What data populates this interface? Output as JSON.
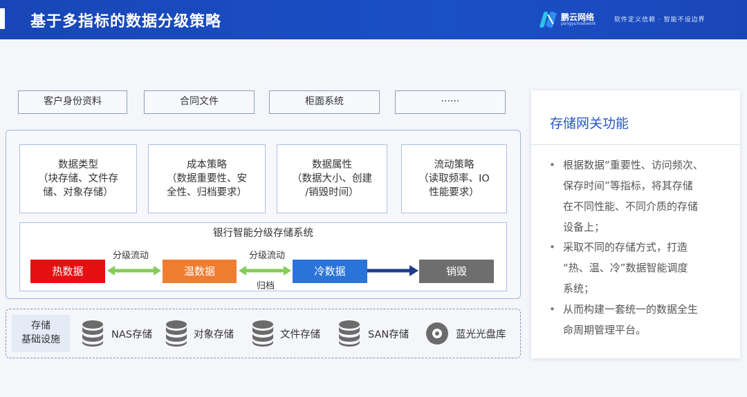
{
  "header": {
    "title": "基于多指标的数据分级策略",
    "logo_cn": "鹏云网络",
    "logo_en": "pengyunnetwork",
    "slogan": "软件定义信赖 · 智能不设边界"
  },
  "sources": [
    "客户身份资料",
    "合同文件",
    "柜面系统",
    "······"
  ],
  "strategies": [
    {
      "title": "数据类型",
      "lines": [
        "（块存储、文件存",
        "储、对象存储）"
      ]
    },
    {
      "title": "成本策略",
      "lines": [
        "（数据重要性、安",
        "全性、归档要求）"
      ]
    },
    {
      "title": "数据属性",
      "lines": [
        "（数据大小、创建",
        "/销毁时间）"
      ]
    },
    {
      "title": "流动策略",
      "lines": [
        "（读取频率、IO",
        "性能要求）"
      ]
    }
  ],
  "bank_system": {
    "title": "银行智能分级存储系统",
    "tiers": [
      {
        "label": "热数据",
        "color": "#e60f12"
      },
      {
        "label": "温数据",
        "color": "#ee7d31"
      },
      {
        "label": "冷数据",
        "color": "#2a74d9"
      },
      {
        "label": "销毁",
        "color": "#6e6e6e"
      }
    ],
    "flow_labels": [
      "分级流动",
      "分级流动",
      "归档"
    ],
    "flow_arrow_color": "#84cc5b",
    "archive_arrow_color": "#1f3b8f"
  },
  "infrastructure": {
    "label_lines": [
      "存储",
      "基础设施"
    ],
    "items": [
      {
        "label": "NAS存储",
        "icon": "database-icon"
      },
      {
        "label": "对象存储",
        "icon": "database-icon"
      },
      {
        "label": "文件存储",
        "icon": "database-icon"
      },
      {
        "label": "SAN存储",
        "icon": "database-icon"
      },
      {
        "label": "蓝光光盘库",
        "icon": "disc-icon"
      }
    ]
  },
  "gateway_card": {
    "title": "存储网关功能",
    "bullets": [
      {
        "lines": [
          "根据数据“重要性、访问频次、",
          "保存时间”等指标，将其存储",
          "在不同性能、不同介质的存储",
          "设备上；"
        ]
      },
      {
        "lines": [
          "采取不同的存储方式，打造",
          "“热、温、冷”数据智能调度",
          "系统；"
        ]
      },
      {
        "lines": [
          "从而构建一套统一的数据全生",
          "命周期管理平台。"
        ]
      }
    ],
    "bullet_mark": "•"
  }
}
